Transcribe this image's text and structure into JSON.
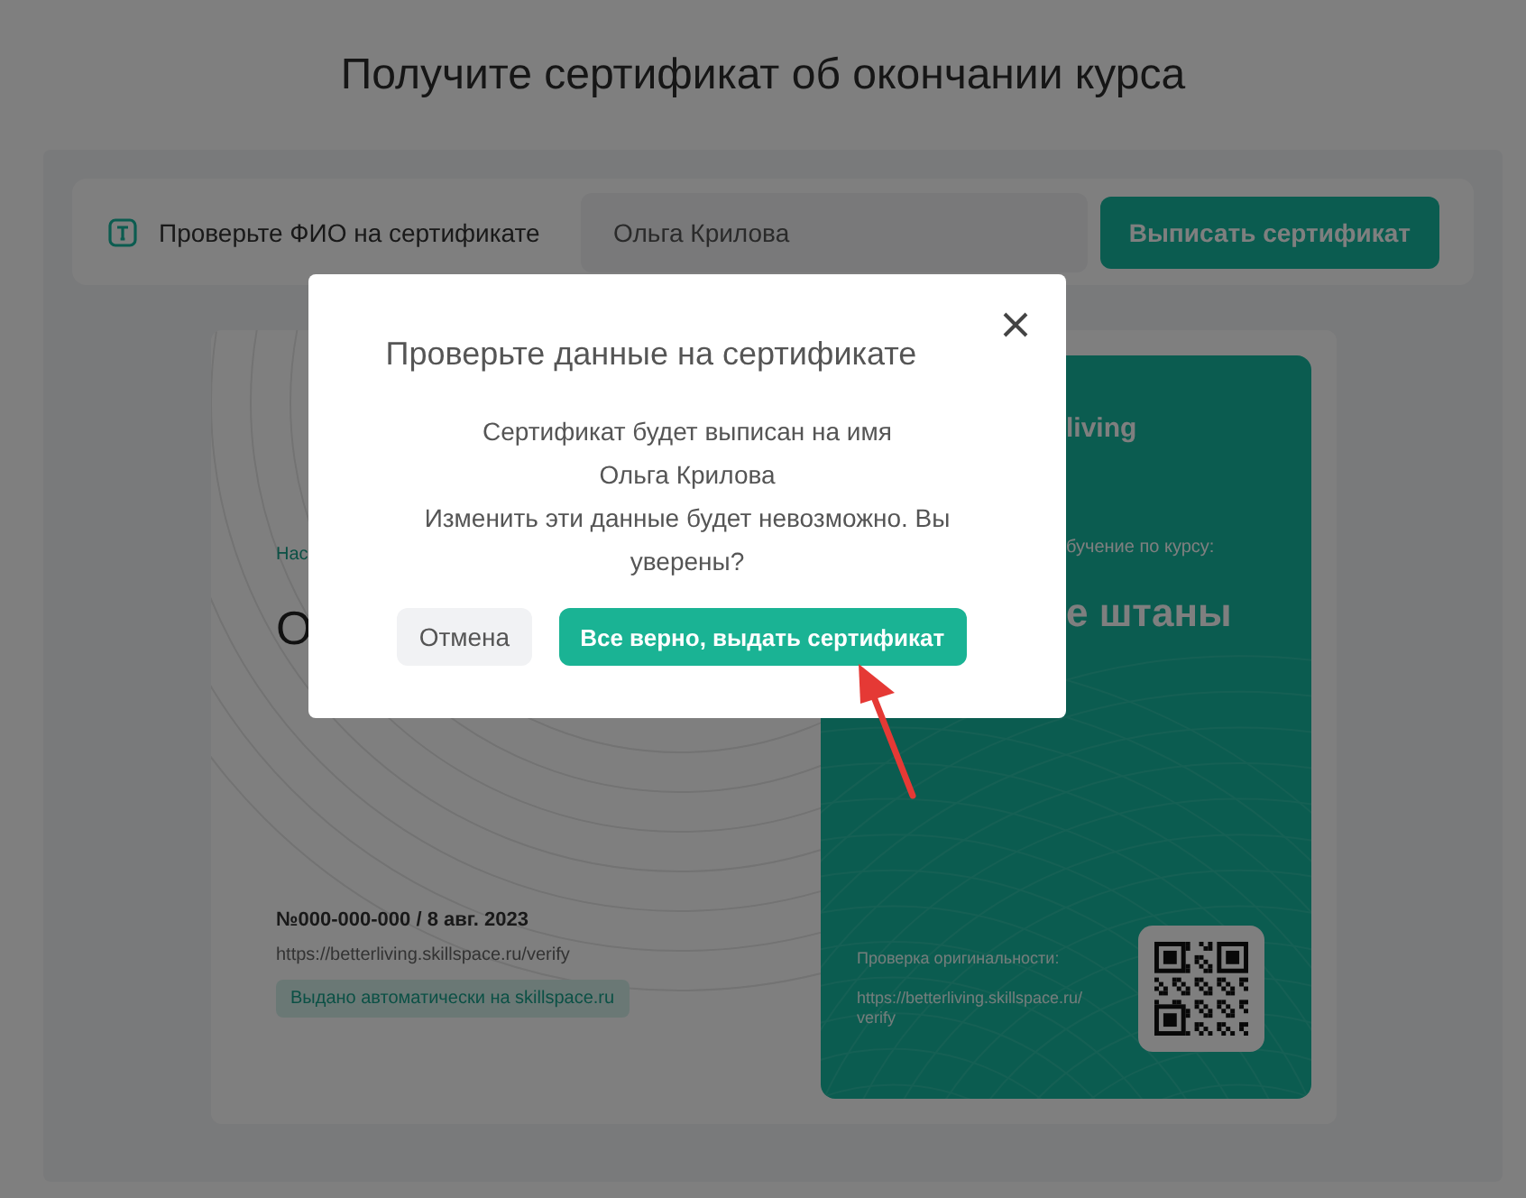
{
  "page_title": "Получите сертификат об окончании курса",
  "name_bar": {
    "label": "Проверьте ФИО на сертификате",
    "value": "Ольга Крилова",
    "button": "Выписать сертификат"
  },
  "certificate": {
    "caption_fragment": "Нас",
    "name_fragment": "О",
    "number": "№000-000-000 / 8 авг. 2023",
    "url": "https://betterliving.skillspace.ru/verify",
    "badge": "Выдано автоматически на skillspace.ru",
    "logo_fragment": "living",
    "course_caption_fragment": "бучение по курсу:",
    "course_fragment": "е штаны",
    "verify_label": "Проверка оригинальности:",
    "verify_url_lines": [
      "https://betterliving.skillspace.ru/",
      "verify"
    ]
  },
  "dialog": {
    "title": "Проверьте данные на сертификате",
    "lines": [
      "Сертификат будет выписан на имя",
      "Ольга Крилова",
      "Изменить эти данные будет невозможно. Вы уверены?"
    ],
    "cancel": "Отмена",
    "confirm": "Все верно, выдать сертификат"
  }
}
